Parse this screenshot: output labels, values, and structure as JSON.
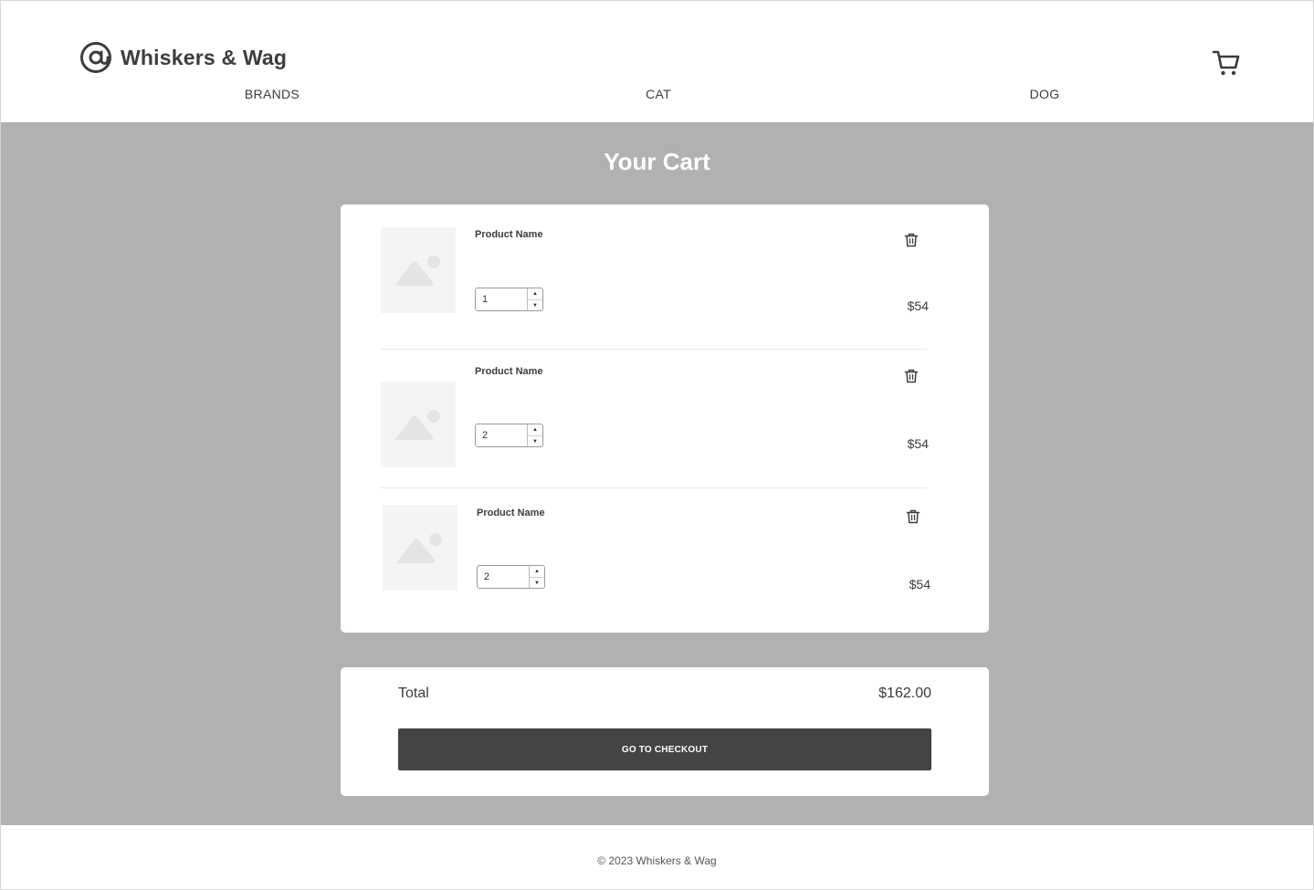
{
  "brand": {
    "name": "Whiskers & Wag",
    "logo_icon": "at-sign-icon"
  },
  "nav": {
    "items": [
      {
        "label": "BRANDS"
      },
      {
        "label": "CAT"
      },
      {
        "label": "DOG"
      }
    ],
    "cart_icon": "shopping-cart-icon"
  },
  "cart": {
    "title": "Your Cart",
    "items": [
      {
        "name": "Product Name",
        "quantity": "1",
        "price": "$54",
        "image_icon": "image-placeholder-icon"
      },
      {
        "name": "Product Name",
        "quantity": "2",
        "price": "$54",
        "image_icon": "image-placeholder-icon"
      },
      {
        "name": "Product Name",
        "quantity": "2",
        "price": "$54",
        "image_icon": "image-placeholder-icon"
      }
    ],
    "spin_up": "▲",
    "spin_down": "▼"
  },
  "summary": {
    "total_label": "Total",
    "total_value": "$162.00",
    "checkout_label": "GO TO CHECKOUT"
  },
  "footer": {
    "copyright": "© 2023 Whiskers & Wag"
  },
  "colors": {
    "background_gray": "#b1b1b1",
    "button_dark": "#444444",
    "text_dark": "#3c3c3c"
  }
}
